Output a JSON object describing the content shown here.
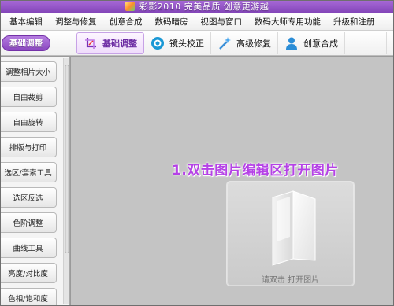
{
  "window": {
    "title": "彩影2010 完美品质 创意更游越"
  },
  "menu": [
    "基本编辑",
    "调整与修复",
    "创意合成",
    "数码暗房",
    "视图与窗口",
    "数码大师专用功能",
    "升级和注册"
  ],
  "toolbar": {
    "mode_label": "基础调整",
    "tools": [
      {
        "label": "基础调整",
        "icon": "crop-icon",
        "active": true
      },
      {
        "label": "镜头校正",
        "icon": "lens-icon",
        "active": false
      },
      {
        "label": "高级修复",
        "icon": "magic-wand-icon",
        "active": false
      },
      {
        "label": "创意合成",
        "icon": "person-icon",
        "active": false
      }
    ]
  },
  "sidebar": {
    "items": [
      "调整相片大小",
      "自由裁剪",
      "自由旋转",
      "排版与打印",
      "选区/套索工具",
      "选区反选",
      "色阶调整",
      "曲线工具",
      "亮度/对比度",
      "色相/饱和度"
    ]
  },
  "canvas": {
    "hint": "1.双击图片编辑区打开图片",
    "drop_caption": "请双击 打开图片"
  },
  "colors": {
    "accent": "#8a46c0",
    "hint": "#b542e6",
    "canvas_bg": "#c4c4c4"
  }
}
